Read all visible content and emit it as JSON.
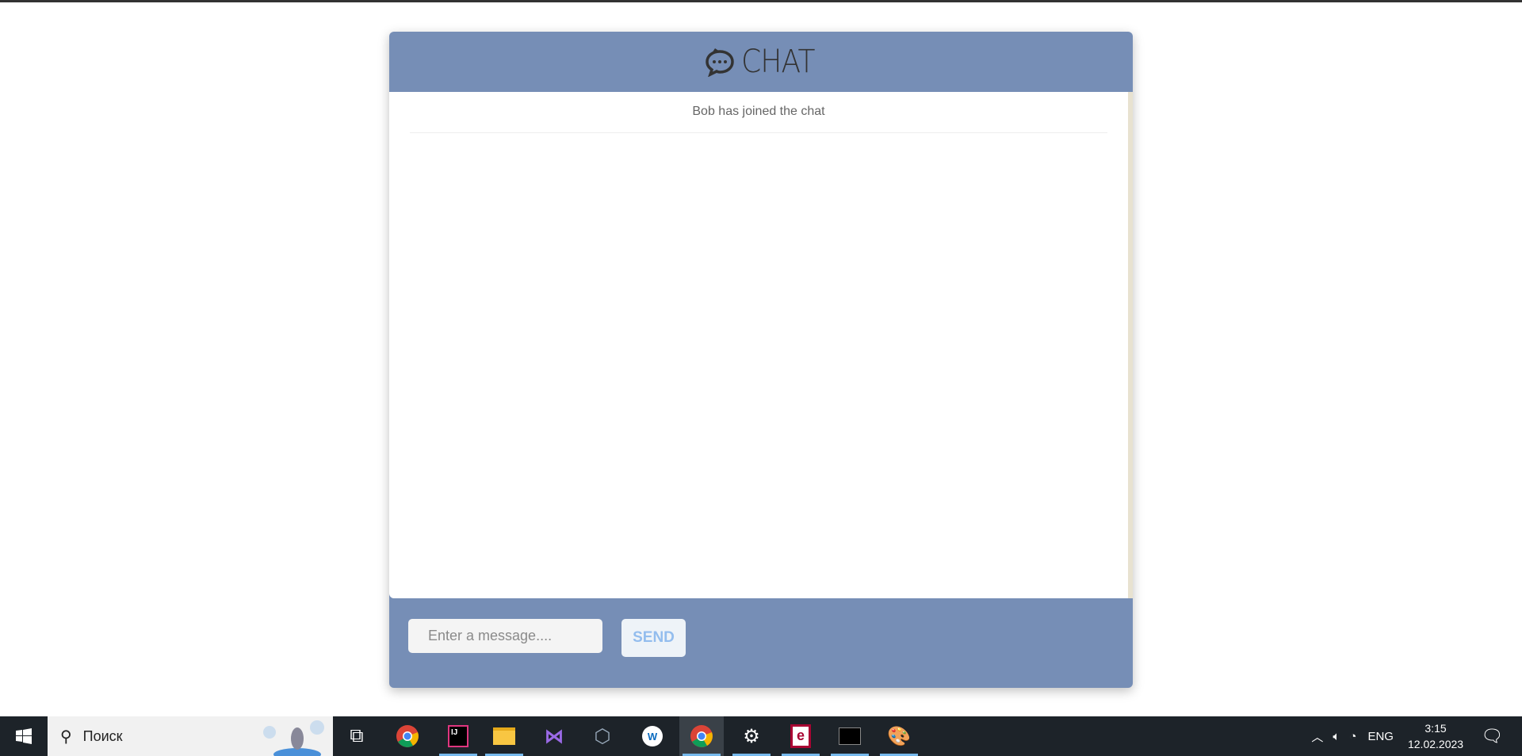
{
  "app": {
    "logo_text": "CHAT"
  },
  "chat": {
    "messages": [
      {
        "type": "system",
        "text": "Bob has joined the chat"
      }
    ]
  },
  "composer": {
    "placeholder": "Enter a message....",
    "send_label": "SEND"
  },
  "colors": {
    "panel": "#768eb6",
    "send_text": "#93bdee"
  },
  "taskbar": {
    "search_label": "Поиск",
    "language": "ENG",
    "time": "3:15",
    "date": "12.02.2023",
    "apps": [
      "task-view",
      "chrome",
      "intellij",
      "file-explorer",
      "visual-studio",
      "virtualbox",
      "app",
      "chrome",
      "settings",
      "erlang",
      "terminal",
      "paint"
    ]
  }
}
